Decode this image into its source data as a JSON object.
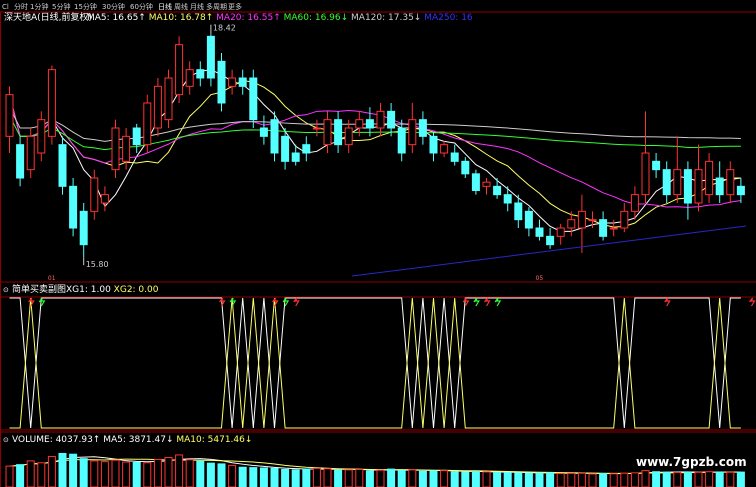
{
  "period_tabs": {
    "items": [
      "分时",
      "1分钟",
      "5分钟",
      "15分钟",
      "30分钟",
      "60分钟",
      "日线",
      "周线",
      "月线",
      "多周期",
      "更多"
    ],
    "active": "日线"
  },
  "chart_data": [
    {
      "type": "candlestick",
      "title": "深天地A(日线,前复权)",
      "ma_legend": [
        {
          "name": "MA5",
          "value": "16.65",
          "arrow": "↑",
          "color": "#ffffff"
        },
        {
          "name": "MA10",
          "value": "16.78",
          "arrow": "↑",
          "color": "#ffff66"
        },
        {
          "name": "MA20",
          "value": "16.55",
          "arrow": "↑",
          "color": "#ff33ff"
        },
        {
          "name": "MA60",
          "value": "16.96",
          "arrow": "↓",
          "color": "#33ff33"
        },
        {
          "name": "MA120",
          "value": "17.35",
          "arrow": "↓",
          "color": "#cccccc"
        },
        {
          "name": "MA250",
          "value": "16",
          "arrow": "",
          "color": "#3333ff"
        }
      ],
      "ylim": [
        15.5,
        18.5
      ],
      "high_label": "18.42",
      "low_label": "15.80",
      "date_markers": [
        {
          "index": 4,
          "label": "01"
        },
        {
          "index": 50,
          "label": "05"
        }
      ],
      "candles": [
        [
          17.2,
          17.7,
          17.8,
          17.0
        ],
        [
          17.1,
          16.7,
          17.2,
          16.6
        ],
        [
          16.8,
          17.2,
          17.3,
          16.7
        ],
        [
          17.0,
          17.4,
          17.5,
          16.9
        ],
        [
          17.2,
          18.0,
          18.05,
          17.1
        ],
        [
          17.1,
          16.6,
          17.2,
          16.5
        ],
        [
          16.6,
          16.1,
          16.7,
          16.0
        ],
        [
          16.3,
          15.9,
          16.4,
          15.75
        ],
        [
          16.3,
          16.7,
          16.8,
          16.2
        ],
        [
          16.4,
          16.5,
          16.6,
          16.3
        ],
        [
          16.8,
          17.3,
          17.4,
          16.7
        ],
        [
          16.9,
          17.2,
          17.3,
          16.8
        ],
        [
          17.3,
          17.1,
          17.35,
          17.0
        ],
        [
          17.1,
          17.6,
          17.7,
          17.0
        ],
        [
          17.3,
          17.8,
          17.9,
          17.2
        ],
        [
          17.4,
          17.9,
          18.0,
          17.3
        ],
        [
          17.7,
          18.3,
          18.4,
          17.6
        ],
        [
          17.8,
          18.0,
          18.1,
          17.7
        ],
        [
          18.0,
          17.9,
          18.1,
          17.8
        ],
        [
          18.4,
          17.9,
          18.42,
          17.8
        ],
        [
          18.1,
          17.6,
          18.2,
          17.5
        ],
        [
          17.8,
          17.9,
          18.0,
          17.7
        ],
        [
          17.9,
          17.8,
          18.0,
          17.7
        ],
        [
          17.9,
          17.4,
          18.0,
          17.3
        ],
        [
          17.3,
          17.2,
          17.45,
          17.1
        ],
        [
          17.4,
          17.0,
          17.5,
          16.9
        ],
        [
          17.2,
          16.9,
          17.3,
          16.8
        ],
        [
          17.0,
          16.9,
          17.1,
          16.85
        ],
        [
          17.1,
          17.0,
          17.2,
          16.9
        ],
        [
          17.3,
          17.3,
          17.4,
          17.2
        ],
        [
          17.1,
          17.4,
          17.5,
          17.0
        ],
        [
          17.4,
          17.1,
          17.5,
          17.0
        ],
        [
          17.1,
          17.3,
          17.4,
          17.0
        ],
        [
          17.3,
          17.4,
          17.5,
          17.2
        ],
        [
          17.4,
          17.3,
          17.55,
          17.2
        ],
        [
          17.3,
          17.5,
          17.6,
          17.2
        ],
        [
          17.5,
          17.3,
          17.6,
          17.2
        ],
        [
          17.3,
          17.0,
          17.4,
          16.9
        ],
        [
          17.1,
          17.4,
          17.6,
          17.0
        ],
        [
          17.4,
          17.2,
          17.5,
          17.1
        ],
        [
          17.2,
          17.0,
          17.25,
          16.9
        ],
        [
          17.0,
          17.1,
          17.15,
          16.95
        ],
        [
          17.0,
          16.9,
          17.1,
          16.85
        ],
        [
          16.9,
          16.75,
          16.95,
          16.7
        ],
        [
          16.75,
          16.55,
          16.8,
          16.5
        ],
        [
          16.6,
          16.65,
          16.7,
          16.5
        ],
        [
          16.6,
          16.5,
          16.7,
          16.45
        ],
        [
          16.5,
          16.4,
          16.6,
          16.3
        ],
        [
          16.4,
          16.2,
          16.5,
          16.1
        ],
        [
          16.3,
          16.1,
          16.35,
          16.0
        ],
        [
          16.1,
          16.0,
          16.2,
          15.95
        ],
        [
          16.0,
          15.9,
          16.1,
          15.85
        ],
        [
          16.0,
          16.1,
          16.15,
          15.9
        ],
        [
          16.1,
          16.2,
          16.3,
          16.0
        ],
        [
          16.1,
          16.3,
          16.5,
          15.8
        ],
        [
          16.2,
          16.2,
          16.3,
          16.1
        ],
        [
          16.2,
          16.0,
          16.3,
          15.95
        ],
        [
          16.1,
          16.1,
          16.2,
          16.0
        ],
        [
          16.1,
          16.3,
          16.4,
          16.05
        ],
        [
          16.3,
          16.5,
          16.6,
          16.2
        ],
        [
          16.5,
          17.0,
          17.5,
          16.4
        ],
        [
          16.9,
          16.8,
          17.0,
          16.7
        ],
        [
          16.8,
          16.5,
          16.9,
          16.4
        ],
        [
          16.5,
          16.8,
          17.2,
          16.4
        ],
        [
          16.8,
          16.4,
          16.9,
          16.2
        ],
        [
          16.4,
          16.8,
          17.1,
          16.3
        ],
        [
          16.5,
          16.9,
          17.0,
          16.4
        ],
        [
          16.7,
          16.5,
          16.9,
          16.4
        ],
        [
          16.5,
          16.8,
          16.9,
          16.4
        ],
        [
          16.6,
          16.5,
          16.7,
          16.4
        ]
      ],
      "ma_lines_points_per_series": 70
    },
    {
      "type": "line",
      "title": "简单买卖副图",
      "series_legend": [
        {
          "name": "XG1",
          "value": "1.00",
          "color": "#ffffff"
        },
        {
          "name": "XG2",
          "value": "0.00",
          "color": "#ffff66"
        }
      ],
      "ylim": [
        0,
        1
      ],
      "xg1": [
        1,
        1,
        0,
        1,
        1,
        1,
        1,
        1,
        1,
        1,
        1,
        1,
        1,
        1,
        1,
        1,
        1,
        1,
        1,
        1,
        1,
        0,
        1,
        0,
        1,
        0,
        1,
        1,
        1,
        1,
        1,
        1,
        1,
        1,
        1,
        1,
        1,
        1,
        0,
        1,
        0,
        1,
        0,
        1,
        1,
        1,
        1,
        1,
        1,
        1,
        1,
        1,
        1,
        1,
        1,
        1,
        1,
        1,
        0,
        1,
        1,
        1,
        1,
        1,
        1,
        1,
        1,
        0,
        1,
        1
      ],
      "signals": [
        {
          "index": 2,
          "kind": "buy"
        },
        {
          "index": 3,
          "kind": "sell"
        },
        {
          "index": 20,
          "kind": "buy"
        },
        {
          "index": 21,
          "kind": "sell"
        },
        {
          "index": 25,
          "kind": "buy"
        },
        {
          "index": 26,
          "kind": "sell"
        },
        {
          "index": 27,
          "kind": "buy"
        },
        {
          "index": 43,
          "kind": "buy"
        },
        {
          "index": 44,
          "kind": "sell"
        },
        {
          "index": 45,
          "kind": "buy"
        },
        {
          "index": 46,
          "kind": "sell"
        },
        {
          "index": 62,
          "kind": "buy"
        },
        {
          "index": 70,
          "kind": "buy"
        }
      ]
    },
    {
      "type": "bar",
      "title": "VOLUME",
      "volume_legend": [
        {
          "name": "VOLUME",
          "value": "4037.93",
          "arrow": "↑",
          "color": "#ffffff"
        },
        {
          "name": "MA5",
          "value": "3871.47",
          "arrow": "↓",
          "color": "#ffffff"
        },
        {
          "name": "MA10",
          "value": "5471.46",
          "arrow": "↓",
          "color": "#ffff66"
        }
      ],
      "values": [
        5600,
        6000,
        7000,
        6500,
        8200,
        9000,
        8800,
        7600,
        7000,
        6800,
        7200,
        6700,
        6600,
        6500,
        7400,
        7900,
        8600,
        7300,
        6900,
        6400,
        6200,
        5800,
        5300,
        5200,
        5100,
        5000,
        4700,
        4600,
        4800,
        5000,
        4900,
        4500,
        4600,
        4700,
        4300,
        4500,
        4800,
        4400,
        4600,
        4200,
        4300,
        4400,
        4100,
        4000,
        4150,
        4050,
        3900,
        3850,
        3800,
        3700,
        3750,
        3800,
        3600,
        3650,
        3700,
        3500,
        3600,
        3550,
        3700,
        3800,
        4400,
        4100,
        3950,
        3900,
        4000,
        3950,
        4100,
        4037.93,
        3950,
        4000
      ],
      "ylim": [
        0,
        11000
      ]
    }
  ],
  "watermark": "www.7gpzb.com"
}
